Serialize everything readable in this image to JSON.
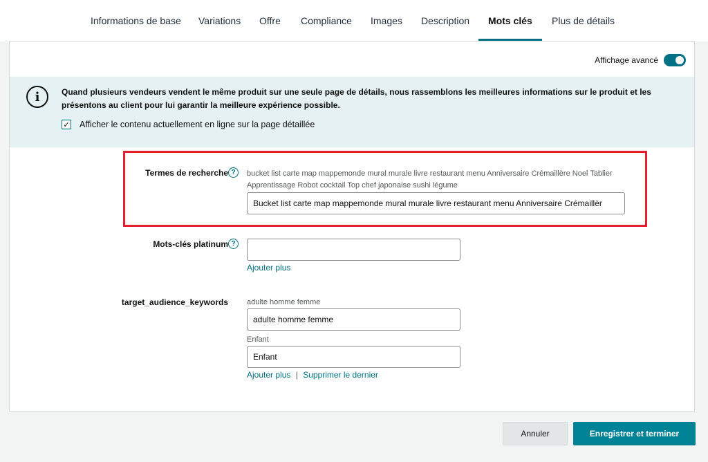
{
  "tabs": [
    {
      "label": "Informations de base"
    },
    {
      "label": "Variations"
    },
    {
      "label": "Offre"
    },
    {
      "label": "Compliance"
    },
    {
      "label": "Images"
    },
    {
      "label": "Description"
    },
    {
      "label": "Mots clés",
      "active": true
    },
    {
      "label": "Plus de détails"
    }
  ],
  "advanced": {
    "label": "Affichage avancé",
    "enabled": true
  },
  "info": {
    "text": "Quand plusieurs vendeurs vendent le même produit sur une seule page de détails, nous rassemblons les meilleures informations sur le produit et les présentons au client pour lui garantir la meilleure expérience possible.",
    "checkbox_label": "Afficher le contenu actuellement en ligne sur la page détaillée",
    "checkbox_checked": true
  },
  "fields": {
    "search_terms": {
      "label": "Termes de recherche",
      "hint": "bucket list carte map mappemonde mural murale livre restaurant menu Anniversaire Crémaillère Noel Tablier Apprentissage Robot cocktail Top chef japonaise sushi légume",
      "value": "Bucket list carte map mappemonde mural murale livre restaurant menu Anniversaire Crémaillèr"
    },
    "platinum_keywords": {
      "label": "Mots-clés platinum",
      "value": "",
      "add_more": "Ajouter plus"
    },
    "target_audience": {
      "label": "target_audience_keywords",
      "entries": [
        {
          "hint": "adulte homme femme",
          "value": "adulte homme femme"
        },
        {
          "hint": "Enfant",
          "value": "Enfant"
        }
      ],
      "add_more": "Ajouter plus",
      "separator": "|",
      "remove_last": "Supprimer le dernier"
    }
  },
  "buttons": {
    "cancel": "Annuler",
    "save": "Enregistrer et terminer"
  },
  "colors": {
    "accent": "#007185",
    "highlight": "#e0202f",
    "info_bg": "#e5f1f2"
  }
}
